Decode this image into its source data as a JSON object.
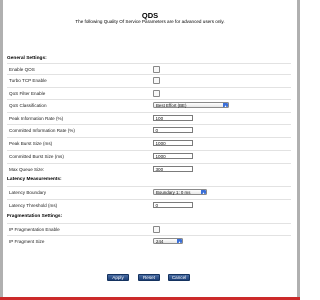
{
  "page": {
    "title": "QDS",
    "subtitle": "The following Quality Of Service Parameters are for advanced users only."
  },
  "general": {
    "heading": "General Settings:",
    "enable_qos_label": "Enable QOS",
    "turbo_tcp_label": "Turbo TCP Enable",
    "qos_filter_label": "QoS Filter Enable",
    "qos_class_label": "QoS Classification",
    "qos_class_value": "Best Effort (BE)",
    "peak_info_rate_label": "Peak Information Rate (%)",
    "peak_info_rate_value": "100",
    "committed_info_rate_label": "Committed Information Rate (%)",
    "committed_info_rate_value": "0",
    "peak_burst_label": "Peak Burst Size (ms)",
    "peak_burst_value": "1000",
    "committed_burst_label": "Committed Burst Size (ms)",
    "committed_burst_value": "1000",
    "max_queue_label": "Max Queue Size:",
    "max_queue_value": "300"
  },
  "latency": {
    "heading": "Latency Measurements:",
    "boundary_label": "Latency Boundary",
    "boundary_value": "Boundary 1: 0 ms",
    "threshold_label": "Latency Threshold (ms)",
    "threshold_value": "0"
  },
  "fragmentation": {
    "heading": "Fragmentation Settings:",
    "ip_frag_enable_label": "IP Fragmentation Enable",
    "ip_frag_size_label": "IP Fragment Size",
    "ip_frag_size_value": "244"
  },
  "buttons": {
    "apply": "Apply",
    "reset": "Reset",
    "cancel": "Cancel"
  },
  "icons": {
    "select_arrow": "chevron-updown-icon"
  },
  "colors": {
    "button_bg": "#24467f",
    "select_arrow_bg": "#3a6fd8",
    "bottom_border": "#cc2a2a"
  }
}
